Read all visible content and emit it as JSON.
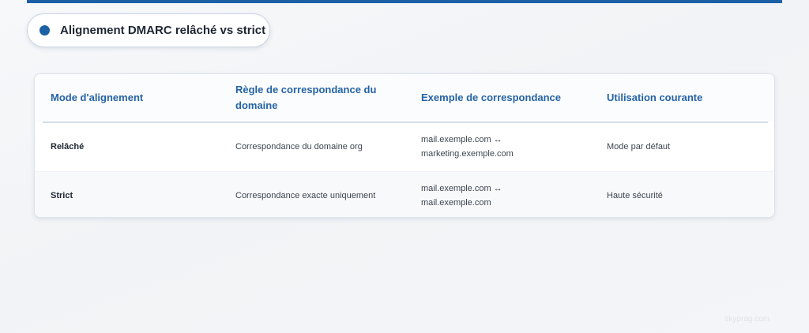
{
  "title": "Alignement DMARC relâché vs strict",
  "table": {
    "headers": [
      "Mode d'alignement",
      "Règle de correspondance du domaine",
      "Exemple de correspondance",
      "Utilisation courante"
    ],
    "rows": [
      {
        "mode": "Relâché",
        "rule": "Correspondance du domaine org",
        "example_line1": "mail.exemple.com ↔",
        "example_line2": "marketing.exemple.com",
        "usage": "Mode par défaut"
      },
      {
        "mode": "Strict",
        "rule": "Correspondance exacte uniquement",
        "example_line1": "mail.exemple.com ↔",
        "example_line2": "mail.exemple.com",
        "usage": "Haute sécurité"
      }
    ]
  },
  "watermark": "skyprag.com",
  "colors": {
    "accent": "#1b5fa5",
    "header_text": "#2563a6"
  }
}
